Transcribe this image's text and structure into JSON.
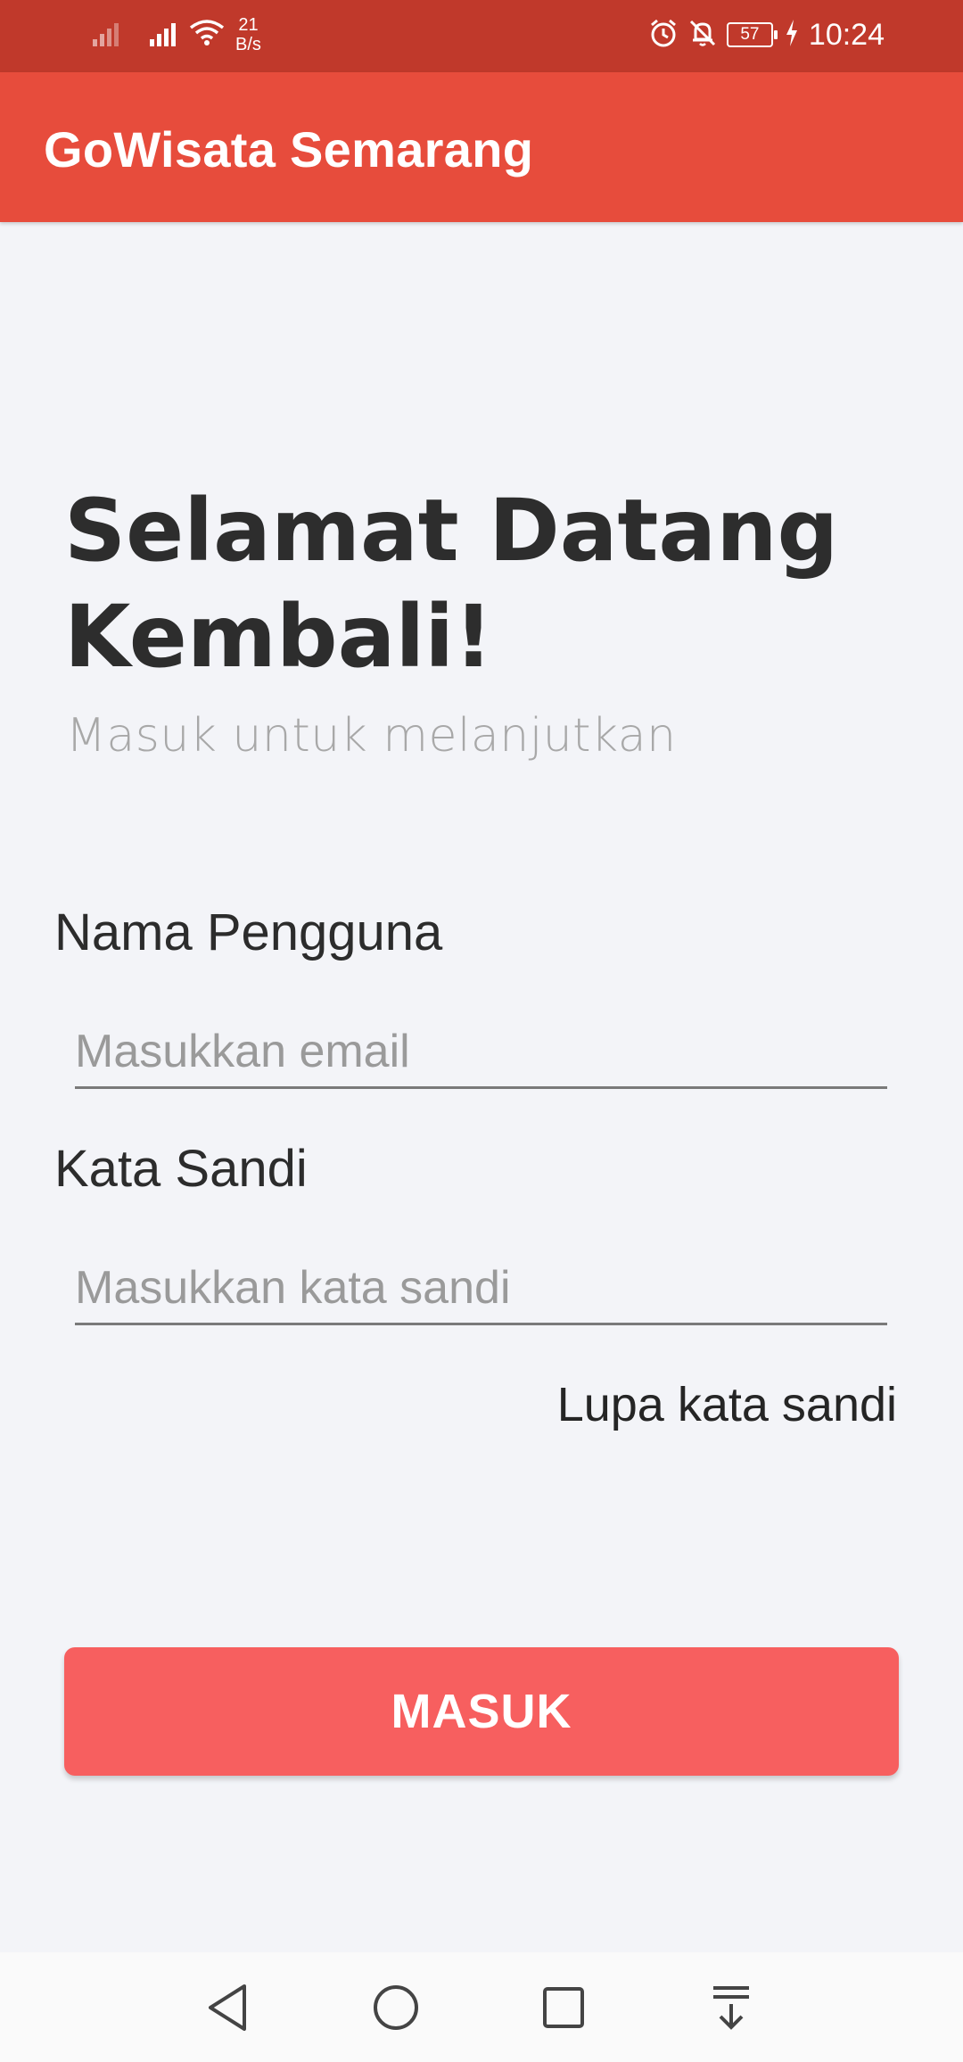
{
  "status_bar": {
    "net_speed_value": "21",
    "net_speed_unit": "B/s",
    "battery": "57",
    "time": "10:24",
    "icons": [
      "signal-icon",
      "signal-icon",
      "wifi-icon",
      "alarm-icon",
      "bell-off-icon",
      "battery-icon",
      "charging-icon"
    ]
  },
  "app_bar": {
    "title": "GoWisata Semarang",
    "color": "#e74c3c"
  },
  "login": {
    "heading": "Selamat Datang Kembali!",
    "subtitle": "Masuk untuk melanjutkan",
    "username_label": "Nama Pengguna",
    "username_placeholder": "Masukkan email",
    "username_value": "",
    "password_label": "Kata Sandi",
    "password_placeholder": "Masukkan kata sandi",
    "password_value": "",
    "forgot_label": "Lupa kata sandi",
    "submit_label": "MASUK",
    "submit_color": "#f75f5f"
  },
  "nav_bar": {
    "icons": [
      "back-icon",
      "home-icon",
      "recent-apps-icon",
      "notification-pull-icon"
    ]
  }
}
